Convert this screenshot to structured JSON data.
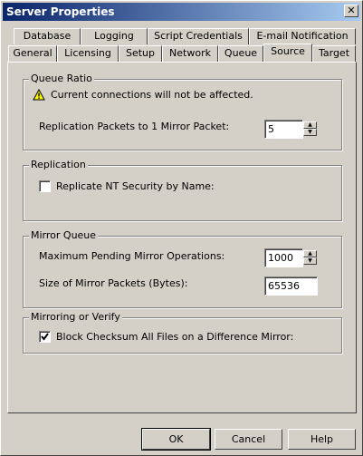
{
  "window": {
    "title": "Server Properties",
    "close_label": "✕"
  },
  "tabs": {
    "back_row": [
      "Database",
      "Logging",
      "Script Credentials",
      "E-mail Notification"
    ],
    "front_row": [
      "General",
      "Licensing",
      "Setup",
      "Network",
      "Queue",
      "Source",
      "Target"
    ],
    "active": "Source"
  },
  "queue_ratio": {
    "legend": "Queue Ratio",
    "warning": "Current connections will not be affected.",
    "packets_label": "Replication Packets to 1 Mirror Packet:",
    "packets_value": "5"
  },
  "replication": {
    "legend": "Replication",
    "nt_security_label": "Replicate NT Security by Name:",
    "nt_security_checked": false
  },
  "mirror_queue": {
    "legend": "Mirror Queue",
    "pending_label": "Maximum Pending Mirror Operations:",
    "pending_value": "1000",
    "packet_size_label": "Size of Mirror Packets (Bytes):",
    "packet_size_value": "65536"
  },
  "mirroring": {
    "legend": "Mirroring or Verify",
    "block_checksum_label": "Block Checksum All Files on a Difference Mirror:",
    "block_checksum_checked": true
  },
  "buttons": {
    "ok": "OK",
    "cancel": "Cancel",
    "help": "Help"
  }
}
